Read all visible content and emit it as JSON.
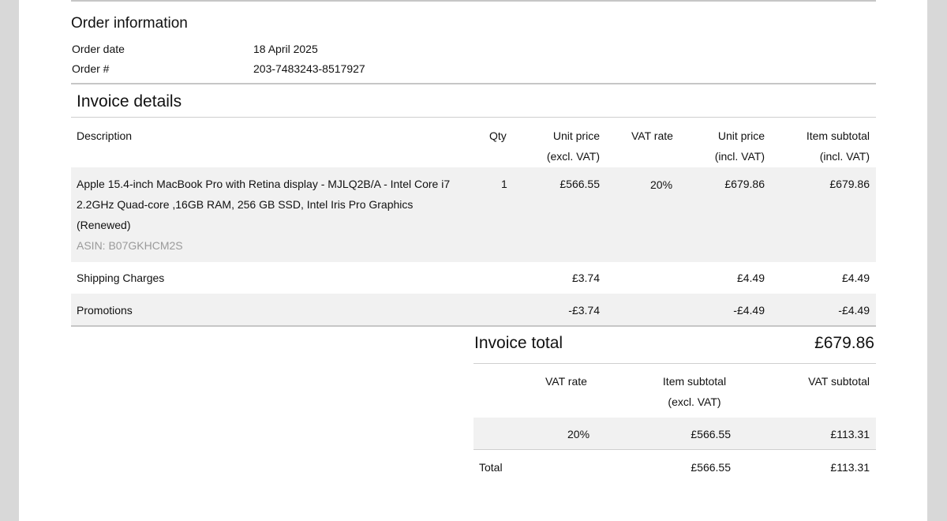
{
  "order_info": {
    "title": "Order information",
    "date_label": "Order date",
    "date_value": "18 April 2025",
    "number_label": "Order #",
    "number_value": "203-7483243-8517927"
  },
  "invoice": {
    "title": "Invoice details",
    "headers": {
      "description": "Description",
      "qty": "Qty",
      "unit_price_excl_1": "Unit price",
      "unit_price_excl_2": "(excl. VAT)",
      "vat_rate": "VAT rate",
      "unit_price_incl_1": "Unit price",
      "unit_price_incl_2": "(incl. VAT)",
      "item_subtotal_1": "Item subtotal",
      "item_subtotal_2": "(incl. VAT)"
    },
    "item": {
      "desc_line1": "Apple 15.4-inch MacBook Pro with Retina display - MJLQ2B/A - Intel Core i7",
      "desc_line2": "2.2GHz Quad-core ,16GB RAM, 256 GB SSD, Intel Iris Pro Graphics",
      "desc_line3": "(Renewed)",
      "asin": "ASIN: B07GKHCM2S",
      "qty": "1",
      "unit_excl": "£566.55",
      "vat_rate": "20%",
      "unit_incl": "£679.86",
      "subtotal": "£679.86"
    },
    "shipping": {
      "label": "Shipping Charges",
      "unit_excl": "£3.74",
      "unit_incl": "£4.49",
      "subtotal": "£4.49"
    },
    "promotions": {
      "label": "Promotions",
      "unit_excl": "-£3.74",
      "unit_incl": "-£4.49",
      "subtotal": "-£4.49"
    },
    "total_label": "Invoice total",
    "total_value": "£679.86"
  },
  "vat_summary": {
    "headers": {
      "vat_rate": "VAT rate",
      "item_subtotal_1": "Item subtotal",
      "item_subtotal_2": "(excl. VAT)",
      "vat_subtotal": "VAT subtotal"
    },
    "row": {
      "vat_rate": "20%",
      "item_subtotal": "£566.55",
      "vat_subtotal": "£113.31"
    },
    "total": {
      "label": "Total",
      "item_subtotal": "£566.55",
      "vat_subtotal": "£113.31"
    }
  }
}
